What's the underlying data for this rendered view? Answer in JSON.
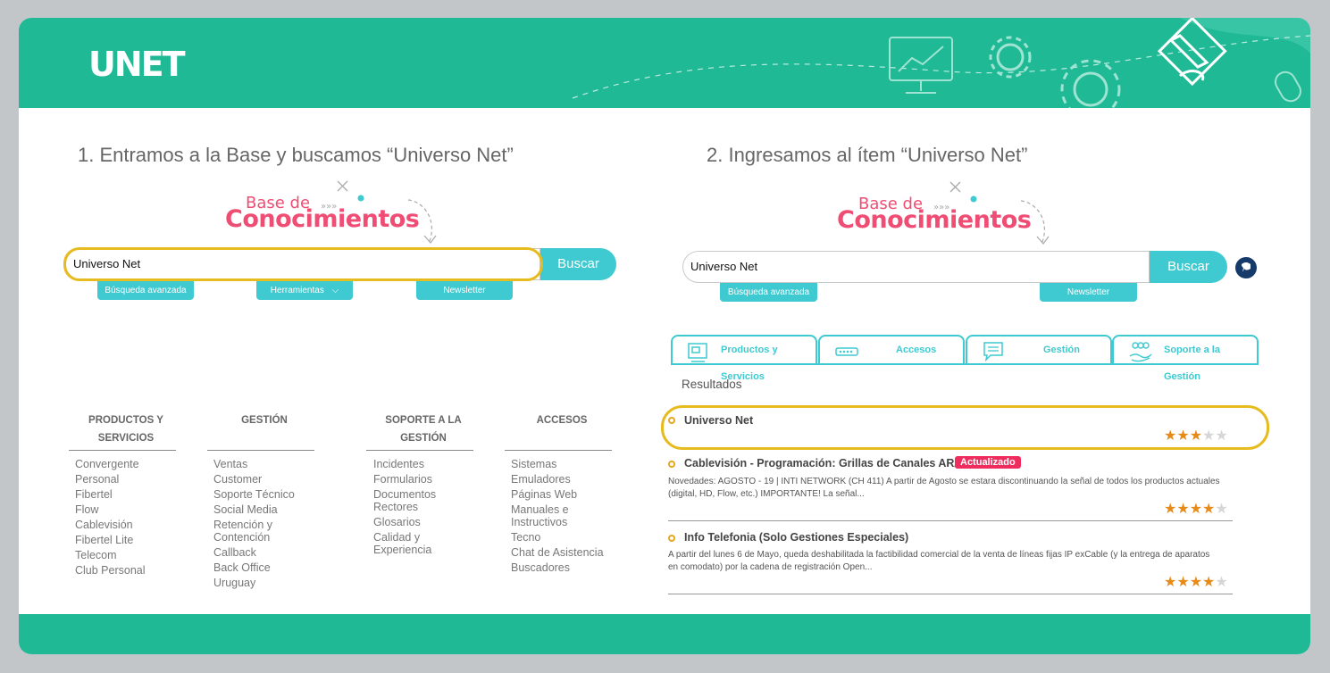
{
  "header": {
    "logo": "UNET"
  },
  "step1": {
    "title": "1. Entramos a la Base y buscamos “Universo Net”",
    "kb_small": "Base de",
    "kb_big": "Conocimientos",
    "search_value": "Universo Net",
    "search_button": "Buscar",
    "pills": [
      "Búsqueda avanzada",
      "Herramientas",
      "Newsletter"
    ],
    "columns": [
      {
        "title": [
          "PRODUCTOS Y",
          "SERVICIOS"
        ],
        "items": [
          "Convergente",
          "Personal",
          "Fibertel",
          "Flow",
          "Cablevisión",
          "Fibertel Lite",
          "Telecom",
          "Club Personal"
        ]
      },
      {
        "title": [
          "GESTIÓN"
        ],
        "items": [
          "Ventas",
          "Customer",
          "Soporte Técnico",
          "Social Media",
          "Retención y Contención",
          "Callback",
          "Back Office",
          "Uruguay"
        ]
      },
      {
        "title": [
          "SOPORTE A LA",
          "GESTIÓN"
        ],
        "items": [
          "Incidentes",
          "Formularios",
          "Documentos Rectores",
          "Glosarios",
          "Calidad y Experiencia"
        ]
      },
      {
        "title": [
          "ACCESOS"
        ],
        "items": [
          "Sistemas",
          "Emuladores",
          "Páginas Web",
          "Manuales e Instructivos",
          "Tecno",
          "Chat de Asistencia",
          "Buscadores"
        ]
      }
    ]
  },
  "step2": {
    "title": "2. Ingresamos al ítem “Universo Net”",
    "kb_small": "Base de",
    "kb_big": "Conocimientos",
    "search_value": "Universo Net",
    "search_button": "Buscar",
    "pills": [
      "Búsqueda avanzada",
      "Newsletter"
    ],
    "tabs": [
      "Productos y Servicios",
      "Accesos",
      "Gestión",
      "Soporte a la Gestión"
    ],
    "results_label": "Resultados",
    "results": [
      {
        "title": "Universo Net",
        "badge": "",
        "desc": "",
        "rating": 3
      },
      {
        "title": "Cablevisión - Programación: Grillas de Canales AR/UY",
        "badge": "Actualizado",
        "desc": "Novedades: AGOSTO - 19 | INTI NETWORK (CH 411)   A partir de Agosto se estara discontinuando la señal de todos los productos actuales (digital, HD, Flow, etc.) IMPORTANTE! La señal...",
        "rating": 4
      },
      {
        "title": "Info Telefonia (Solo Gestiones Especiales)",
        "badge": "",
        "desc": "A partir del lunes 6 de Mayo, queda deshabilitada la factibilidad comercial de la venta de líneas fijas IP exCable (y la entrega de aparatos en comodato) por la cadena de registración Open...",
        "rating": 4
      }
    ]
  },
  "colors": {
    "teal": "#1fb995",
    "accent": "#3ecad0",
    "pink": "#ef4d74",
    "highlight": "#e6bb1e",
    "star": "#e68a18"
  }
}
